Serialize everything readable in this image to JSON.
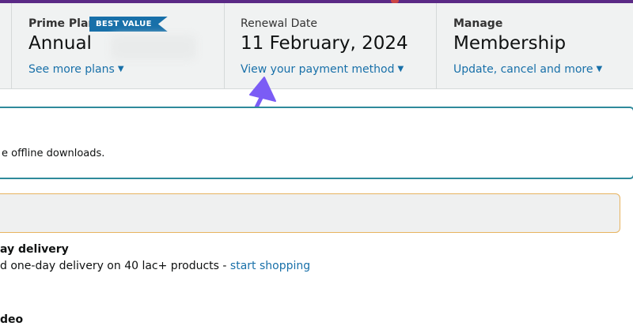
{
  "plan": {
    "label": "Prime Plan",
    "badge": "BEST VALUE",
    "value": "Annual",
    "link": "See more plans"
  },
  "renewal": {
    "label": "Renewal Date",
    "value": "11 February, 2024",
    "link": "View your payment method"
  },
  "manage": {
    "label": "Manage",
    "value": "Membership",
    "link": "Update, cancel and more"
  },
  "card_teal": {
    "text": "e offline downloads."
  },
  "delivery": {
    "title": "ay delivery",
    "desc": "d one-day delivery on 40 lac+ products - ",
    "link": "start shopping"
  },
  "video": {
    "title": "deo"
  },
  "colors": {
    "link": "#1870a9",
    "badge": "#1870a9",
    "arrow": "#7b5cf5",
    "teal_border": "#2f8a9b",
    "orange_border": "#e7b35f"
  },
  "icons": {
    "dropdown": "caret-down-icon",
    "annotation": "arrow-pointer-icon"
  }
}
